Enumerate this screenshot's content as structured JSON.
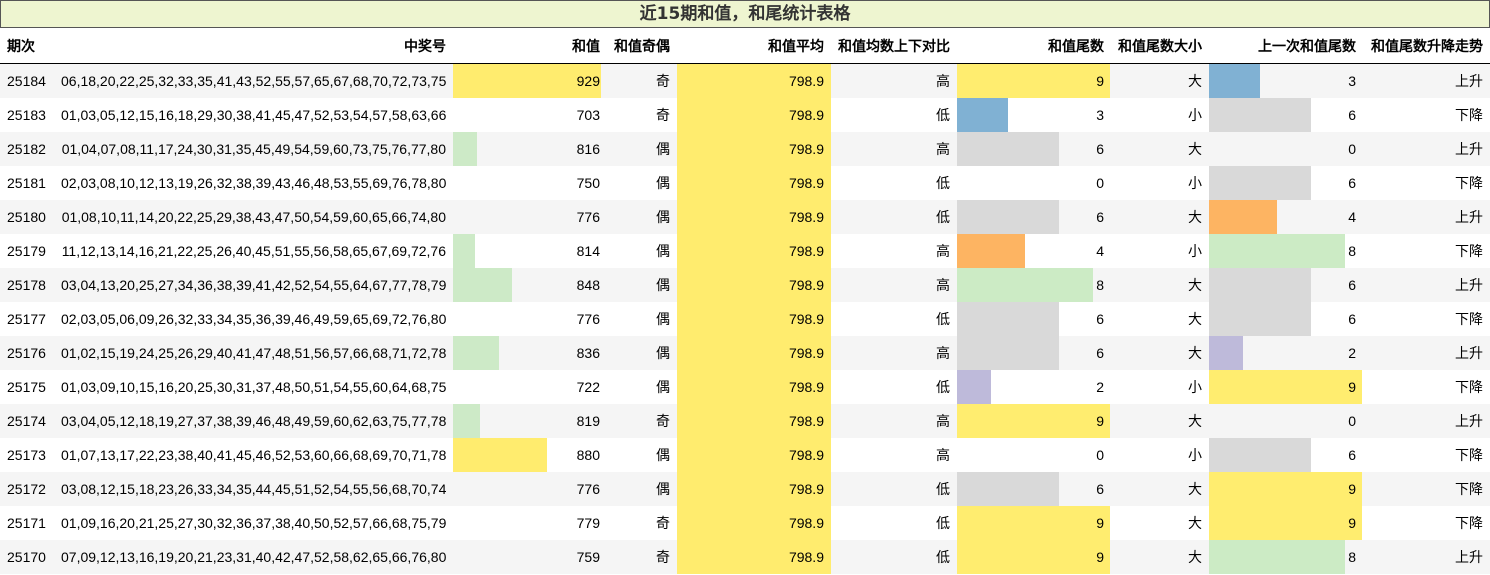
{
  "title": "近15期和值，和尾统计表格",
  "columns": [
    "期次",
    "中奖号",
    "和值",
    "和值奇偶",
    "和值平均",
    "和值均数上下对比",
    "和值尾数",
    "和值尾数大小",
    "上一次和值尾数",
    "和值尾数升降走势"
  ],
  "chart_data": {
    "type": "table",
    "title": "近15期和值，和尾统计表格",
    "rows": [
      {
        "issue": "25184",
        "numbers": "06,18,20,22,25,32,33,35,41,43,52,55,57,65,67,68,70,72,73,75",
        "sum": 929,
        "parity": "奇",
        "avg": "798.9",
        "vs_avg": "高",
        "tail": 9,
        "tail_size": "大",
        "prev_tail": 3,
        "trend": "上升"
      },
      {
        "issue": "25183",
        "numbers": "01,03,05,12,15,16,18,29,30,38,41,45,47,52,53,54,57,58,63,66",
        "sum": 703,
        "parity": "奇",
        "avg": "798.9",
        "vs_avg": "低",
        "tail": 3,
        "tail_size": "小",
        "prev_tail": 6,
        "trend": "下降"
      },
      {
        "issue": "25182",
        "numbers": "01,04,07,08,11,17,24,30,31,35,45,49,54,59,60,73,75,76,77,80",
        "sum": 816,
        "parity": "偶",
        "avg": "798.9",
        "vs_avg": "高",
        "tail": 6,
        "tail_size": "大",
        "prev_tail": 0,
        "trend": "上升"
      },
      {
        "issue": "25181",
        "numbers": "02,03,08,10,12,13,19,26,32,38,39,43,46,48,53,55,69,76,78,80",
        "sum": 750,
        "parity": "偶",
        "avg": "798.9",
        "vs_avg": "低",
        "tail": 0,
        "tail_size": "小",
        "prev_tail": 6,
        "trend": "下降"
      },
      {
        "issue": "25180",
        "numbers": "01,08,10,11,14,20,22,25,29,38,43,47,50,54,59,60,65,66,74,80",
        "sum": 776,
        "parity": "偶",
        "avg": "798.9",
        "vs_avg": "低",
        "tail": 6,
        "tail_size": "大",
        "prev_tail": 4,
        "trend": "上升"
      },
      {
        "issue": "25179",
        "numbers": "11,12,13,14,16,21,22,25,26,40,45,51,55,56,58,65,67,69,72,76",
        "sum": 814,
        "parity": "偶",
        "avg": "798.9",
        "vs_avg": "高",
        "tail": 4,
        "tail_size": "小",
        "prev_tail": 8,
        "trend": "下降"
      },
      {
        "issue": "25178",
        "numbers": "03,04,13,20,25,27,34,36,38,39,41,42,52,54,55,64,67,77,78,79",
        "sum": 848,
        "parity": "偶",
        "avg": "798.9",
        "vs_avg": "高",
        "tail": 8,
        "tail_size": "大",
        "prev_tail": 6,
        "trend": "上升"
      },
      {
        "issue": "25177",
        "numbers": "02,03,05,06,09,26,32,33,34,35,36,39,46,49,59,65,69,72,76,80",
        "sum": 776,
        "parity": "偶",
        "avg": "798.9",
        "vs_avg": "低",
        "tail": 6,
        "tail_size": "大",
        "prev_tail": 6,
        "trend": "下降"
      },
      {
        "issue": "25176",
        "numbers": "01,02,15,19,24,25,26,29,40,41,47,48,51,56,57,66,68,71,72,78",
        "sum": 836,
        "parity": "偶",
        "avg": "798.9",
        "vs_avg": "高",
        "tail": 6,
        "tail_size": "大",
        "prev_tail": 2,
        "trend": "上升"
      },
      {
        "issue": "25175",
        "numbers": "01,03,09,10,15,16,20,25,30,31,37,48,50,51,54,55,60,64,68,75",
        "sum": 722,
        "parity": "偶",
        "avg": "798.9",
        "vs_avg": "低",
        "tail": 2,
        "tail_size": "小",
        "prev_tail": 9,
        "trend": "下降"
      },
      {
        "issue": "25174",
        "numbers": "03,04,05,12,18,19,27,37,38,39,46,48,49,59,60,62,63,75,77,78",
        "sum": 819,
        "parity": "奇",
        "avg": "798.9",
        "vs_avg": "高",
        "tail": 9,
        "tail_size": "大",
        "prev_tail": 0,
        "trend": "上升"
      },
      {
        "issue": "25173",
        "numbers": "01,07,13,17,22,23,38,40,41,45,46,52,53,60,66,68,69,70,71,78",
        "sum": 880,
        "parity": "偶",
        "avg": "798.9",
        "vs_avg": "高",
        "tail": 0,
        "tail_size": "小",
        "prev_tail": 6,
        "trend": "下降"
      },
      {
        "issue": "25172",
        "numbers": "03,08,12,15,18,23,26,33,34,35,44,45,51,52,54,55,56,68,70,74",
        "sum": 776,
        "parity": "偶",
        "avg": "798.9",
        "vs_avg": "低",
        "tail": 6,
        "tail_size": "大",
        "prev_tail": 9,
        "trend": "下降"
      },
      {
        "issue": "25171",
        "numbers": "01,09,16,20,21,25,27,30,32,36,37,38,40,50,52,57,66,68,75,79",
        "sum": 779,
        "parity": "奇",
        "avg": "798.9",
        "vs_avg": "低",
        "tail": 9,
        "tail_size": "大",
        "prev_tail": 9,
        "trend": "下降"
      },
      {
        "issue": "25170",
        "numbers": "07,09,12,13,16,19,20,21,23,31,40,42,47,52,58,62,65,66,76,80",
        "sum": 759,
        "parity": "奇",
        "avg": "798.9",
        "vs_avg": "低",
        "tail": 9,
        "tail_size": "大",
        "prev_tail": 8,
        "trend": "上升"
      }
    ]
  },
  "colors": {
    "sum_high": "#ffec6e",
    "sum_mid": "#cdeac7",
    "sum_low": "#bd82bd",
    "avg": "#ffec6e",
    "tail": {
      "0": "#ffffff",
      "2": "#bebada",
      "3": "#80b1d3",
      "4": "#fdb462",
      "6": "#d9d9d9",
      "8": "#ccebc5",
      "9": "#ffed6f"
    }
  }
}
